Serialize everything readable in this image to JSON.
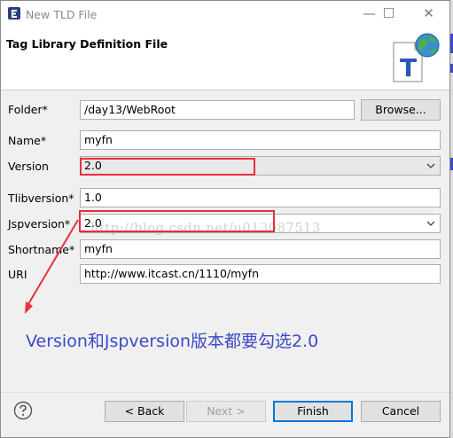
{
  "window": {
    "title": "New TLD File",
    "minimize_glyph": "—",
    "maximize_glyph": "☐",
    "close_glyph": "✕"
  },
  "header": {
    "title": "Tag Library Definition File",
    "banner_icon": "tld-file-globe-icon"
  },
  "form": {
    "folder": {
      "label": "Folder*",
      "value": "/day13/WebRoot",
      "browse_label": "Browse..."
    },
    "name": {
      "label": "Name*",
      "value": "myfn"
    },
    "version": {
      "label": "Version",
      "value": "2.0"
    },
    "tlibversion": {
      "label": "Tlibversion*",
      "value": "1.0"
    },
    "jspversion": {
      "label": "Jspversion*",
      "value": "2.0"
    },
    "shortname": {
      "label": "Shortname*",
      "value": "myfn"
    },
    "uri": {
      "label": "URI",
      "value": "http://www.itcast.cn/1110/myfn"
    }
  },
  "annotation": {
    "text": "Version和Jspversion版本都要勾选2.0",
    "color": "#3a4ac8",
    "highlight_color": "#e8303a"
  },
  "watermark": "http://blog.csdn.net/u013087513",
  "buttons": {
    "back": "< Back",
    "next": "Next >",
    "finish": "Finish",
    "cancel": "Cancel"
  },
  "colors": {
    "accent": "#0078d7",
    "dialog_bg": "#f0f0f0"
  }
}
